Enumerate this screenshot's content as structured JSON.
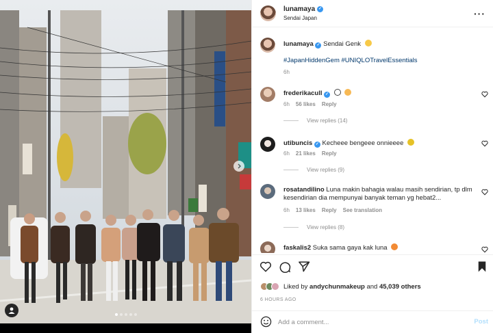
{
  "post": {
    "username": "lunamaya",
    "location": "Sendai Japan",
    "caption_text": "Sendai Genk",
    "hashtags": "#JapanHiddenGem #UNIQLOTravelEssentials",
    "caption_time": "6h",
    "carousel_dots": 5,
    "carousel_active": 0
  },
  "comments": [
    {
      "username": "frederikacull",
      "text": "",
      "time": "6h",
      "likes": "56 likes",
      "reply_label": "Reply",
      "view_replies": "View replies (14)",
      "emoji_colors": [
        "#ffffff",
        "#f7b955"
      ]
    },
    {
      "username": "utibuncis",
      "text": "Kecheee bengeee onnieeee",
      "time": "6h",
      "likes": "21 likes",
      "reply_label": "Reply",
      "view_replies": "View replies (9)"
    },
    {
      "username": "rosatandilino",
      "text": "Luna makin bahagia walau masih sendirian, tp dlm kesendirian dia mempunyai banyak teman yg hebat2...",
      "time": "6h",
      "likes": "13 likes",
      "reply_label": "Reply",
      "see_translation": "See translation",
      "view_replies": "View replies (8)"
    },
    {
      "username": "faskalis2",
      "text": "Suka sama gaya kak luna"
    }
  ],
  "likes": {
    "liked_by_prefix": "Liked by",
    "liked_by_user": "andychunmakeup",
    "and": "and",
    "others": "45,039 others"
  },
  "timestamp": "6 HOURS AGO",
  "add_comment": {
    "placeholder": "Add a comment...",
    "post_label": "Post"
  },
  "colors": {
    "verified": "#3897f0",
    "link": "#00376b",
    "muted": "#8e8e8e",
    "post_disabled": "#b2dffc"
  }
}
